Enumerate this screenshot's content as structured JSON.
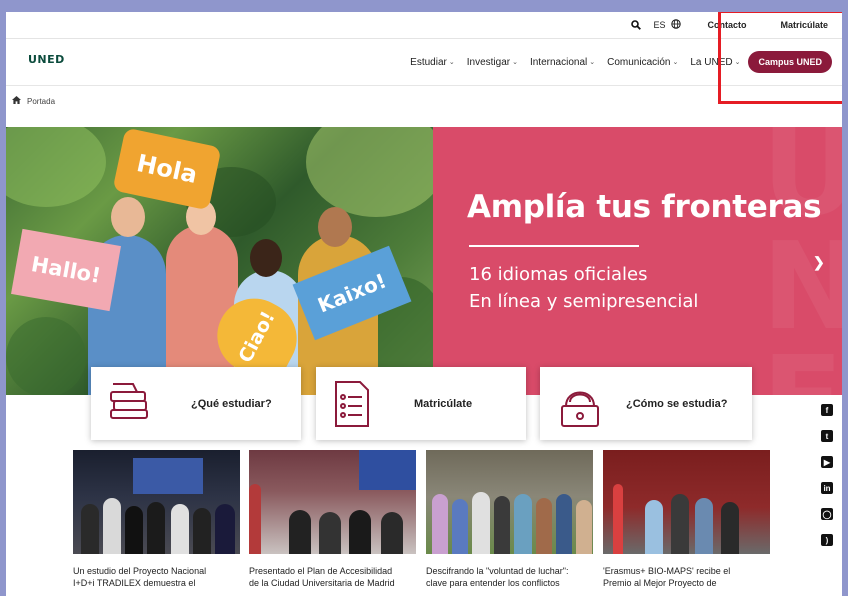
{
  "utility": {
    "lang": "ES",
    "contact": "Contacto",
    "enroll": "Matricúlate"
  },
  "header": {
    "logo": "UNED",
    "nav": [
      "Estudiar",
      "Investigar",
      "Internacional",
      "Comunicación",
      "La UNED"
    ],
    "campus_button": "Campus UNED"
  },
  "breadcrumb": {
    "home": "Portada"
  },
  "hero": {
    "title": "Amplía tus fronteras",
    "subtitle_1": "16 idiomas oficiales",
    "subtitle_2": "En línea y semipresencial",
    "signs": [
      "Hola",
      "Hallo!",
      "Ciao!",
      "Kaixo!"
    ],
    "colors": {
      "panel": "#d94b69",
      "campus": "#8b1a3b",
      "logo": "#0b4b3c"
    }
  },
  "cards": [
    {
      "label": "¿Qué estudiar?",
      "icon": "books-icon"
    },
    {
      "label": "Matricúlate",
      "icon": "form-list-icon"
    },
    {
      "label": "¿Cómo se estudia?",
      "icon": "student-laptop-icon"
    }
  ],
  "social": [
    "facebook-icon",
    "twitter-icon",
    "youtube-icon",
    "linkedin-icon",
    "instagram-icon",
    "rss-icon"
  ],
  "news": [
    {
      "line1": "Un estudio del Proyecto Nacional",
      "line2": "I+D+i TRADILEX demuestra el"
    },
    {
      "line1": "Presentado el Plan de Accesibilidad",
      "line2": "de la Ciudad Universitaria de Madrid"
    },
    {
      "line1": "Descifrando la \"voluntad de luchar\":",
      "line2": "clave para entender los conflictos"
    },
    {
      "line1": "'Erasmus+ BIO-MAPS' recibe el",
      "line2": "Premio al Mejor Proyecto de"
    }
  ]
}
